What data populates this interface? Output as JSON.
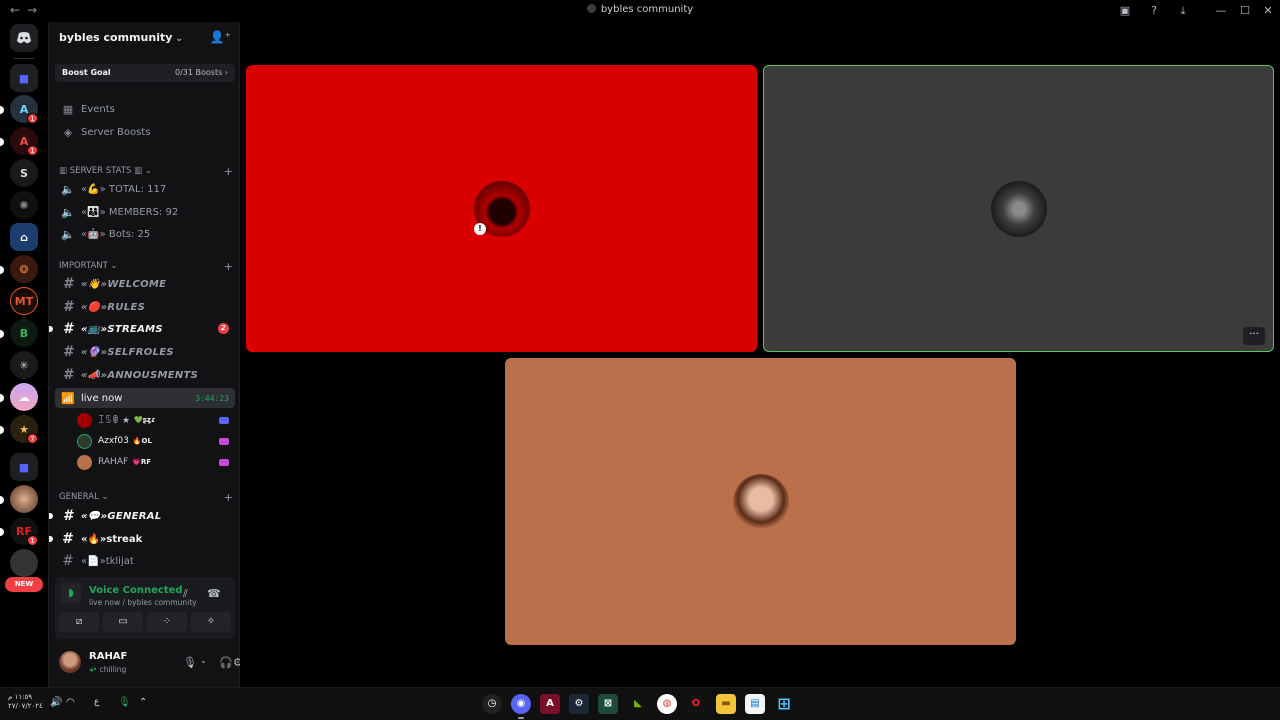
{
  "window": {
    "title": "bybles community",
    "nav_back": "←",
    "nav_forward": "→"
  },
  "rail": {
    "badges": [
      "1",
      "1",
      "7",
      "1"
    ],
    "new_label": "NEW"
  },
  "server": {
    "name": "bybles community",
    "boost_goal_label": "Boost Goal",
    "boost_count": "0/31 Boosts"
  },
  "sidebar": {
    "events": "Events",
    "server_boosts": "Server Boosts",
    "cat_stats": "SERVER STATS",
    "stat_total": "«💪» TOTAL: 117",
    "stat_members": "«👨‍👩‍👦» MEMBERS: 92",
    "stat_bots": "«🤖» Bots: 25",
    "cat_important": "IMPORTANT",
    "ch_welcome": "«👋»WELCOME",
    "ch_rules": "«🔴»RULES",
    "ch_streams": "«📺»STREAMS",
    "streams_badge": "2",
    "ch_selfroles": "«🔮»SELFROLES",
    "ch_announcements": "«📣»ANNOUSMENTS",
    "voice_channel": "live now",
    "voice_time": "3:44:23",
    "voice_users": [
      {
        "name": "ꀤꌗꂦ ★",
        "tag": "💚ʂȥɾ"
      },
      {
        "name": "Azxf03",
        "tag": "🔥OL"
      },
      {
        "name": "RAHAF",
        "tag": "💗RF"
      }
    ],
    "cat_general": "GENERAL",
    "ch_general": "«💬»GENERAL",
    "ch_streak": "«🔥»streak",
    "ch_tklijat": "«📄»tklijat"
  },
  "voice": {
    "status": "Voice Connected",
    "location": "live now / bybles community"
  },
  "user": {
    "name": "RAHAF",
    "status": "chilling"
  },
  "taskbar": {
    "time": "١١:٥٩ م",
    "date": "٢٧/٠٧/٢٠٢٤",
    "lang": "ع"
  },
  "colors": {
    "accent": "#23a55a",
    "tile_red": "#d90000",
    "tile_gray": "#3a3c39",
    "tile_orange": "#b9704b",
    "speaking_border": "#5fc35f"
  }
}
